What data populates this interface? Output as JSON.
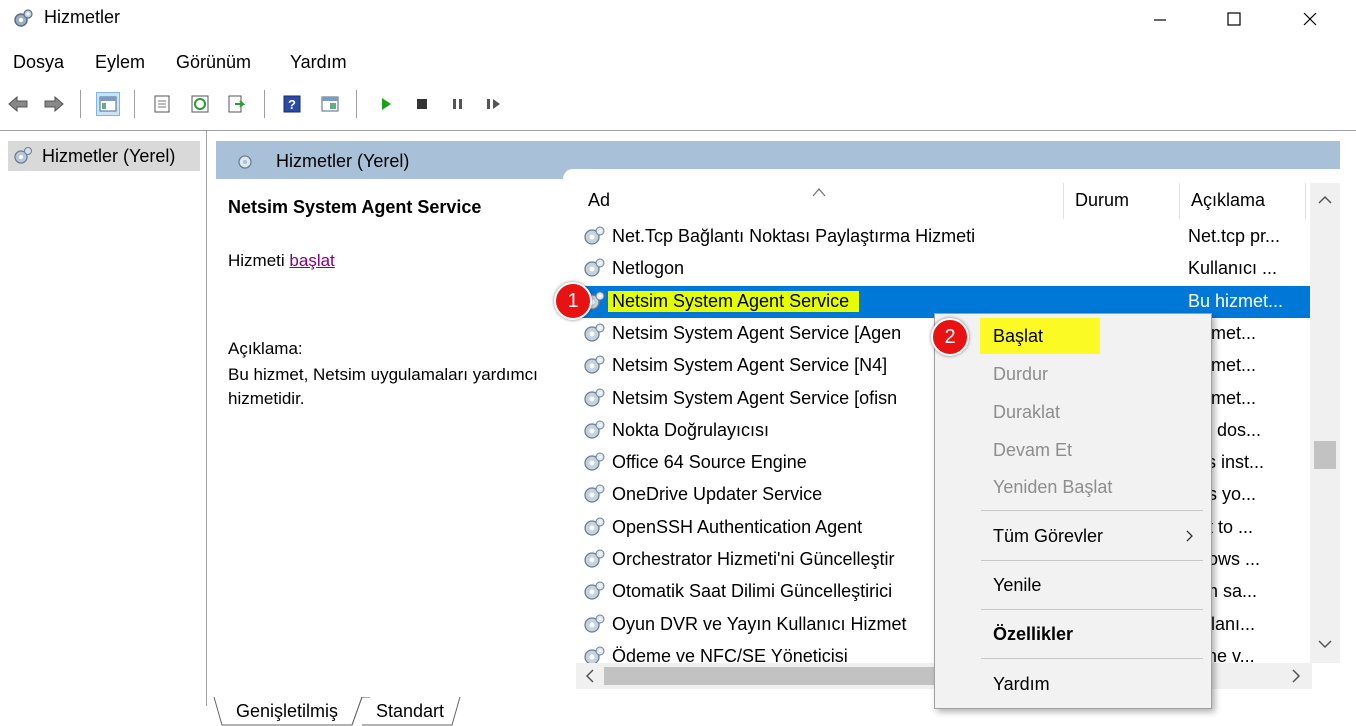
{
  "window": {
    "title": "Hizmetler"
  },
  "menu": [
    "Dosya",
    "Eylem",
    "Görünüm",
    "Yardım"
  ],
  "tree": {
    "item": "Hizmetler (Yerel)"
  },
  "main": {
    "header": "Hizmetler (Yerel)",
    "selected_title": "Netsim System Agent Service",
    "start_prefix": "Hizmeti ",
    "start_link": "başlat",
    "desc_label": "Açıklama:",
    "desc_body": "Bu hizmet, Netsim uygulamaları yardımcı hizmetidir."
  },
  "columns": {
    "name": "Ad",
    "status": "Durum",
    "desc": "Açıklama"
  },
  "rows": [
    {
      "name": "Net.Tcp Bağlantı Noktası Paylaştırma Hizmeti",
      "desc": "Net.tcp pr..."
    },
    {
      "name": "Netlogon",
      "desc": "Kullanıcı ..."
    },
    {
      "name": "Netsim System Agent Service",
      "desc": "Bu hizmet..."
    },
    {
      "name": "Netsim System Agent Service [Agen",
      "desc": " hizmet..."
    },
    {
      "name": "Netsim System Agent Service [N4]",
      "desc": " hizmet..."
    },
    {
      "name": "Netsim System Agent Service [ofisn",
      "desc": " hizmet..."
    },
    {
      "name": "Nokta Doğrulayıcısı",
      "desc": "ası dos..."
    },
    {
      "name": "Office 64 Source Engine",
      "desc": "ves inst..."
    },
    {
      "name": "OneDrive Updater Service",
      "desc": "eps yo..."
    },
    {
      "name": "OpenSSH Authentication Agent",
      "desc": "ent to ..."
    },
    {
      "name": "Orchestrator Hizmeti'ni Güncelleştir",
      "desc": "ndows ..."
    },
    {
      "name": "Otomatik Saat Dilimi Güncelleştirici",
      "desc": "tem sa..."
    },
    {
      "name": "Oyun DVR ve Yayın Kullanıcı Hizmet",
      "desc": " kullanı..."
    },
    {
      "name": "Ödeme ve NFC/SE Yöneticisi",
      "desc": "leme v..."
    }
  ],
  "context_menu": {
    "start": "Başlat",
    "stop": "Durdur",
    "pause": "Duraklat",
    "resume": "Devam Et",
    "restart": "Yeniden Başlat",
    "all_tasks": "Tüm Görevler",
    "refresh": "Yenile",
    "properties": "Özellikler",
    "help": "Yardım"
  },
  "tabs": {
    "extended": "Genişletilmiş",
    "standard": "Standart"
  },
  "badges": {
    "one": "1",
    "two": "2"
  },
  "colors": {
    "selection": "#0078d7",
    "highlight": "#e6ff00",
    "badge": "#e81212",
    "header": "#a9c0d9"
  }
}
